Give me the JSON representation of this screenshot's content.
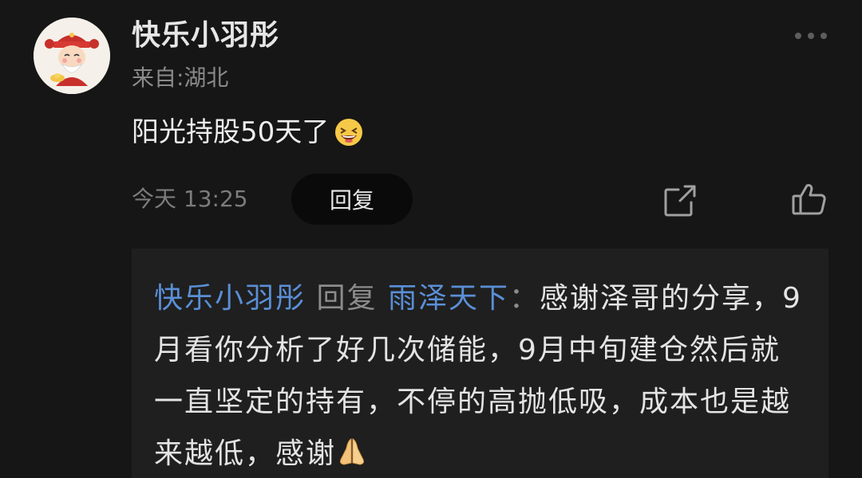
{
  "comment": {
    "username": "快乐小羽彤",
    "location": "来自:湖北",
    "text": "阳光持股50天了",
    "emoji_after_text": "laughing-face-icon",
    "timestamp": "今天 13:25",
    "reply_label": "回复"
  },
  "icons": {
    "more": "more-dots-icon",
    "share": "share-icon",
    "like": "thumbs-up-icon",
    "avatar": "cartoon-fortune-god-avatar"
  },
  "reply_thread": {
    "from_name": "快乐小羽彤",
    "reply_word": "回复",
    "to_name": "雨泽天下",
    "separator": "：",
    "body": "感谢泽哥的分享，9月看你分析了好几次储能，9月中旬建仓然后就一直坚定的持有，不停的高抛低吸，成本也是越来越低，感谢",
    "emoji_after_body": "praying-hands-icon"
  },
  "colors": {
    "background": "#161616",
    "reply_box": "#1f1f1f",
    "link_blue": "#5a8fd6",
    "muted_text": "#8a8a8a"
  }
}
